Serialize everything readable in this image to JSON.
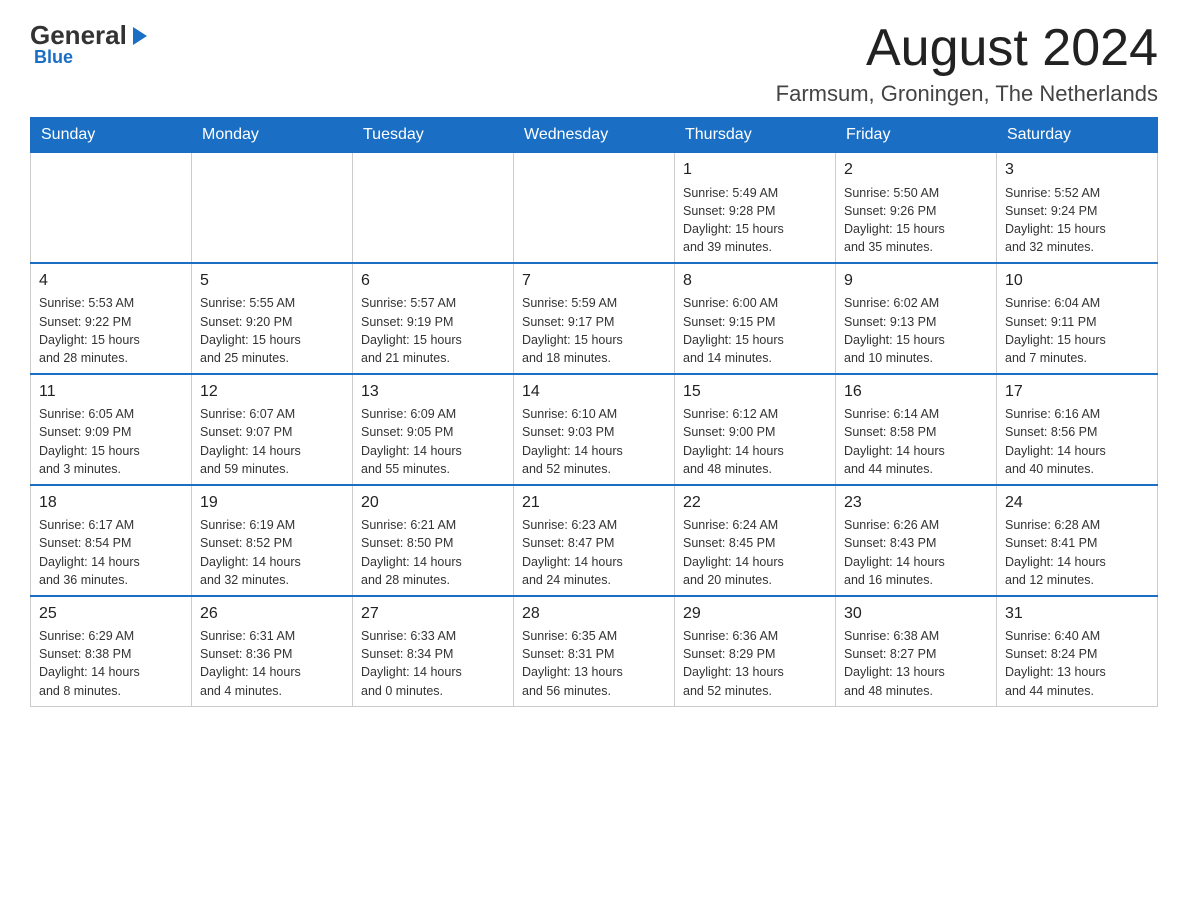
{
  "logo": {
    "general": "General",
    "blue": "Blue",
    "sub": "Blue"
  },
  "header": {
    "month": "August 2024",
    "location": "Farmsum, Groningen, The Netherlands"
  },
  "weekdays": [
    "Sunday",
    "Monday",
    "Tuesday",
    "Wednesday",
    "Thursday",
    "Friday",
    "Saturday"
  ],
  "weeks": [
    [
      {
        "day": "",
        "info": ""
      },
      {
        "day": "",
        "info": ""
      },
      {
        "day": "",
        "info": ""
      },
      {
        "day": "",
        "info": ""
      },
      {
        "day": "1",
        "info": "Sunrise: 5:49 AM\nSunset: 9:28 PM\nDaylight: 15 hours\nand 39 minutes."
      },
      {
        "day": "2",
        "info": "Sunrise: 5:50 AM\nSunset: 9:26 PM\nDaylight: 15 hours\nand 35 minutes."
      },
      {
        "day": "3",
        "info": "Sunrise: 5:52 AM\nSunset: 9:24 PM\nDaylight: 15 hours\nand 32 minutes."
      }
    ],
    [
      {
        "day": "4",
        "info": "Sunrise: 5:53 AM\nSunset: 9:22 PM\nDaylight: 15 hours\nand 28 minutes."
      },
      {
        "day": "5",
        "info": "Sunrise: 5:55 AM\nSunset: 9:20 PM\nDaylight: 15 hours\nand 25 minutes."
      },
      {
        "day": "6",
        "info": "Sunrise: 5:57 AM\nSunset: 9:19 PM\nDaylight: 15 hours\nand 21 minutes."
      },
      {
        "day": "7",
        "info": "Sunrise: 5:59 AM\nSunset: 9:17 PM\nDaylight: 15 hours\nand 18 minutes."
      },
      {
        "day": "8",
        "info": "Sunrise: 6:00 AM\nSunset: 9:15 PM\nDaylight: 15 hours\nand 14 minutes."
      },
      {
        "day": "9",
        "info": "Sunrise: 6:02 AM\nSunset: 9:13 PM\nDaylight: 15 hours\nand 10 minutes."
      },
      {
        "day": "10",
        "info": "Sunrise: 6:04 AM\nSunset: 9:11 PM\nDaylight: 15 hours\nand 7 minutes."
      }
    ],
    [
      {
        "day": "11",
        "info": "Sunrise: 6:05 AM\nSunset: 9:09 PM\nDaylight: 15 hours\nand 3 minutes."
      },
      {
        "day": "12",
        "info": "Sunrise: 6:07 AM\nSunset: 9:07 PM\nDaylight: 14 hours\nand 59 minutes."
      },
      {
        "day": "13",
        "info": "Sunrise: 6:09 AM\nSunset: 9:05 PM\nDaylight: 14 hours\nand 55 minutes."
      },
      {
        "day": "14",
        "info": "Sunrise: 6:10 AM\nSunset: 9:03 PM\nDaylight: 14 hours\nand 52 minutes."
      },
      {
        "day": "15",
        "info": "Sunrise: 6:12 AM\nSunset: 9:00 PM\nDaylight: 14 hours\nand 48 minutes."
      },
      {
        "day": "16",
        "info": "Sunrise: 6:14 AM\nSunset: 8:58 PM\nDaylight: 14 hours\nand 44 minutes."
      },
      {
        "day": "17",
        "info": "Sunrise: 6:16 AM\nSunset: 8:56 PM\nDaylight: 14 hours\nand 40 minutes."
      }
    ],
    [
      {
        "day": "18",
        "info": "Sunrise: 6:17 AM\nSunset: 8:54 PM\nDaylight: 14 hours\nand 36 minutes."
      },
      {
        "day": "19",
        "info": "Sunrise: 6:19 AM\nSunset: 8:52 PM\nDaylight: 14 hours\nand 32 minutes."
      },
      {
        "day": "20",
        "info": "Sunrise: 6:21 AM\nSunset: 8:50 PM\nDaylight: 14 hours\nand 28 minutes."
      },
      {
        "day": "21",
        "info": "Sunrise: 6:23 AM\nSunset: 8:47 PM\nDaylight: 14 hours\nand 24 minutes."
      },
      {
        "day": "22",
        "info": "Sunrise: 6:24 AM\nSunset: 8:45 PM\nDaylight: 14 hours\nand 20 minutes."
      },
      {
        "day": "23",
        "info": "Sunrise: 6:26 AM\nSunset: 8:43 PM\nDaylight: 14 hours\nand 16 minutes."
      },
      {
        "day": "24",
        "info": "Sunrise: 6:28 AM\nSunset: 8:41 PM\nDaylight: 14 hours\nand 12 minutes."
      }
    ],
    [
      {
        "day": "25",
        "info": "Sunrise: 6:29 AM\nSunset: 8:38 PM\nDaylight: 14 hours\nand 8 minutes."
      },
      {
        "day": "26",
        "info": "Sunrise: 6:31 AM\nSunset: 8:36 PM\nDaylight: 14 hours\nand 4 minutes."
      },
      {
        "day": "27",
        "info": "Sunrise: 6:33 AM\nSunset: 8:34 PM\nDaylight: 14 hours\nand 0 minutes."
      },
      {
        "day": "28",
        "info": "Sunrise: 6:35 AM\nSunset: 8:31 PM\nDaylight: 13 hours\nand 56 minutes."
      },
      {
        "day": "29",
        "info": "Sunrise: 6:36 AM\nSunset: 8:29 PM\nDaylight: 13 hours\nand 52 minutes."
      },
      {
        "day": "30",
        "info": "Sunrise: 6:38 AM\nSunset: 8:27 PM\nDaylight: 13 hours\nand 48 minutes."
      },
      {
        "day": "31",
        "info": "Sunrise: 6:40 AM\nSunset: 8:24 PM\nDaylight: 13 hours\nand 44 minutes."
      }
    ]
  ]
}
